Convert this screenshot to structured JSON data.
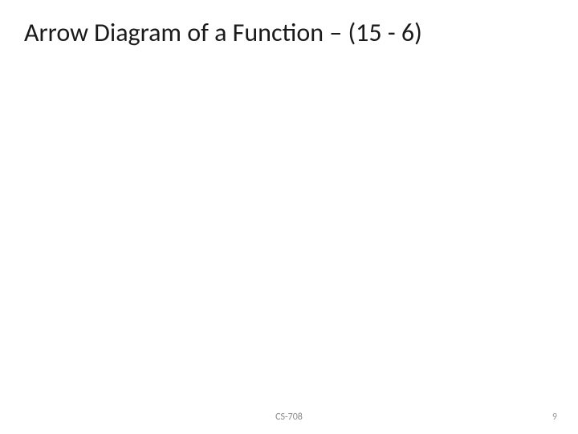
{
  "slide": {
    "title": "Arrow Diagram of a Function – (15 - 6)",
    "footer_course": "CS-708",
    "page_number": "9"
  }
}
